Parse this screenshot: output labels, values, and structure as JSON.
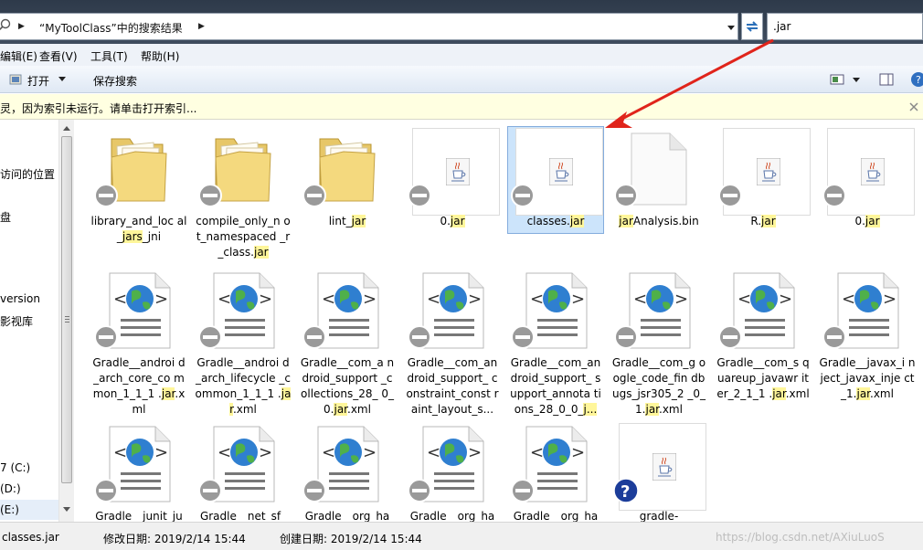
{
  "address": {
    "breadcrumb": "“MyToolClass”中的搜索结果",
    "search_value": ".jar"
  },
  "menu": [
    "编辑(E)",
    "查看(V)",
    "工具(T)",
    "帮助(H)"
  ],
  "toolbar": {
    "open_label": "打开",
    "save_search_label": "保存搜索"
  },
  "infobar": {
    "text": "灵，因为索引未运行。请单击打开索引..."
  },
  "nav": {
    "items": [
      "访问的位置",
      "盘",
      "version",
      "影视库",
      "7 (C:)",
      "(D:)",
      "(E:)"
    ]
  },
  "files": [
    {
      "label_before": "library_and_loc al_",
      "hl": "jars",
      "label_after": "_jni",
      "kind": "folder"
    },
    {
      "label_before": "compile_only_n ot_namespaced _r_class.",
      "hl": "jar",
      "label_after": "",
      "kind": "folder"
    },
    {
      "label_before": "lint_",
      "hl": "jar",
      "label_after": "",
      "kind": "folder"
    },
    {
      "label_before": "0.",
      "hl": "jar",
      "label_after": "",
      "kind": "jar"
    },
    {
      "label_before": "classes.",
      "hl": "jar",
      "label_after": "",
      "kind": "jar",
      "selected": true
    },
    {
      "label_before": "",
      "hl": "jar",
      "label_after": "Analysis.bin",
      "kind": "blank"
    },
    {
      "label_before": "R.",
      "hl": "jar",
      "label_after": "",
      "kind": "jar"
    },
    {
      "label_before": "0.",
      "hl": "jar",
      "label_after": "",
      "kind": "jar"
    },
    {
      "label_before": "Gradle__androi d_arch_core_co mmon_1_1_1 .",
      "hl": "jar",
      "label_after": ".xml",
      "kind": "xml"
    },
    {
      "label_before": "Gradle__androi d_arch_lifecycle _common_1_1_1 .",
      "hl": "jar",
      "label_after": ".xml",
      "kind": "xml"
    },
    {
      "label_before": "Gradle__com_a ndroid_support _collections_28_ 0_0.",
      "hl": "jar",
      "label_after": ".xml",
      "kind": "xml"
    },
    {
      "label_before": "Gradle__com_an droid_support_ constraint_const raint_layout_s...",
      "hl": "",
      "label_after": "",
      "kind": "xml"
    },
    {
      "label_before": "Gradle__com_an droid_support_ support_annota tions_28_0_0_",
      "hl": "j...",
      "label_after": "",
      "kind": "xml"
    },
    {
      "label_before": "Gradle__com_g oogle_code_fin dbugs_jsr305_2 _0_1.",
      "hl": "jar",
      "label_after": ".xml",
      "kind": "xml"
    },
    {
      "label_before": "Gradle__com_s quareup_javawr iter_2_1_1 .",
      "hl": "jar",
      "label_after": ".xml",
      "kind": "xml"
    },
    {
      "label_before": "Gradle__javax_i nject_javax_inje ct_1.",
      "hl": "jar",
      "label_after": ".xml",
      "kind": "xml"
    },
    {
      "label_before": "Gradle__junit_ju",
      "hl": "",
      "label_after": "",
      "kind": "xml"
    },
    {
      "label_before": "Gradle__net_sf_",
      "hl": "",
      "label_after": "",
      "kind": "xml"
    },
    {
      "label_before": "Gradle__org_ha",
      "hl": "",
      "label_after": "",
      "kind": "xml"
    },
    {
      "label_before": "Gradle__org_ha",
      "hl": "",
      "label_after": "",
      "kind": "xml"
    },
    {
      "label_before": "Gradle__org_ha",
      "hl": "",
      "label_after": "",
      "kind": "xml"
    },
    {
      "label_before": "gradle-",
      "hl": "",
      "label_after": "",
      "kind": "jar-q"
    }
  ],
  "status": {
    "name": "classes.jar",
    "modified": "修改日期: 2019/2/14 15:44",
    "created": "创建日期: 2019/2/14 15:44",
    "watermark": "https://blog.csdn.net/AXiuLuoS"
  }
}
